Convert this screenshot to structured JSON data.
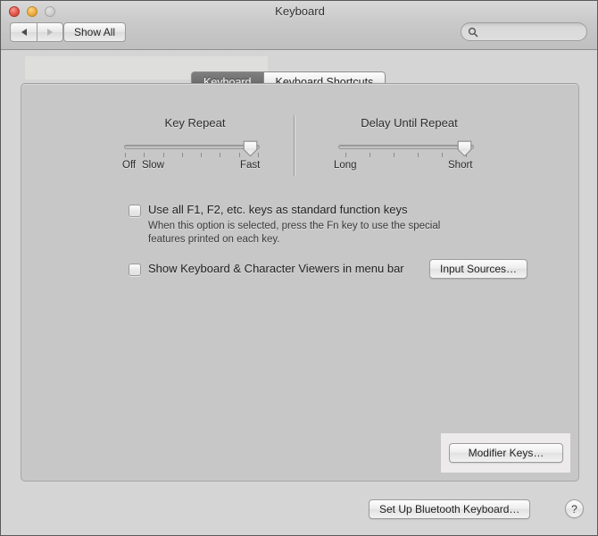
{
  "window": {
    "title": "Keyboard",
    "traffic_lights": [
      "close",
      "minimize",
      "zoom"
    ]
  },
  "toolbar": {
    "back_label": "◀",
    "forward_label": "▶",
    "show_all_label": "Show All",
    "search": {
      "value": "",
      "placeholder": "",
      "icon": "search-icon"
    }
  },
  "tabs": [
    {
      "label": "Keyboard",
      "selected": true
    },
    {
      "label": "Keyboard Shortcuts",
      "selected": false
    }
  ],
  "sliders": [
    {
      "title": "Key Repeat",
      "left_label": "Off",
      "second_label": "Slow",
      "right_label": "Fast",
      "ticks": 8,
      "value_percent": 100
    },
    {
      "title": "Delay Until Repeat",
      "left_label": "Long",
      "right_label": "Short",
      "ticks": 6,
      "value_percent": 100
    }
  ],
  "checkboxes": [
    {
      "label": "Use all F1, F2, etc. keys as standard function keys",
      "checked": false,
      "help_line_1": "When this option is selected, press the Fn key to use the special",
      "help_line_2": "features printed on each key."
    },
    {
      "label": "Show Keyboard & Character Viewers in menu bar",
      "checked": false
    }
  ],
  "buttons": {
    "input_sources": "Input Sources…",
    "modifier_keys": "Modifier Keys…",
    "setup_bluetooth": "Set Up Bluetooth Keyboard…",
    "help": "?"
  }
}
